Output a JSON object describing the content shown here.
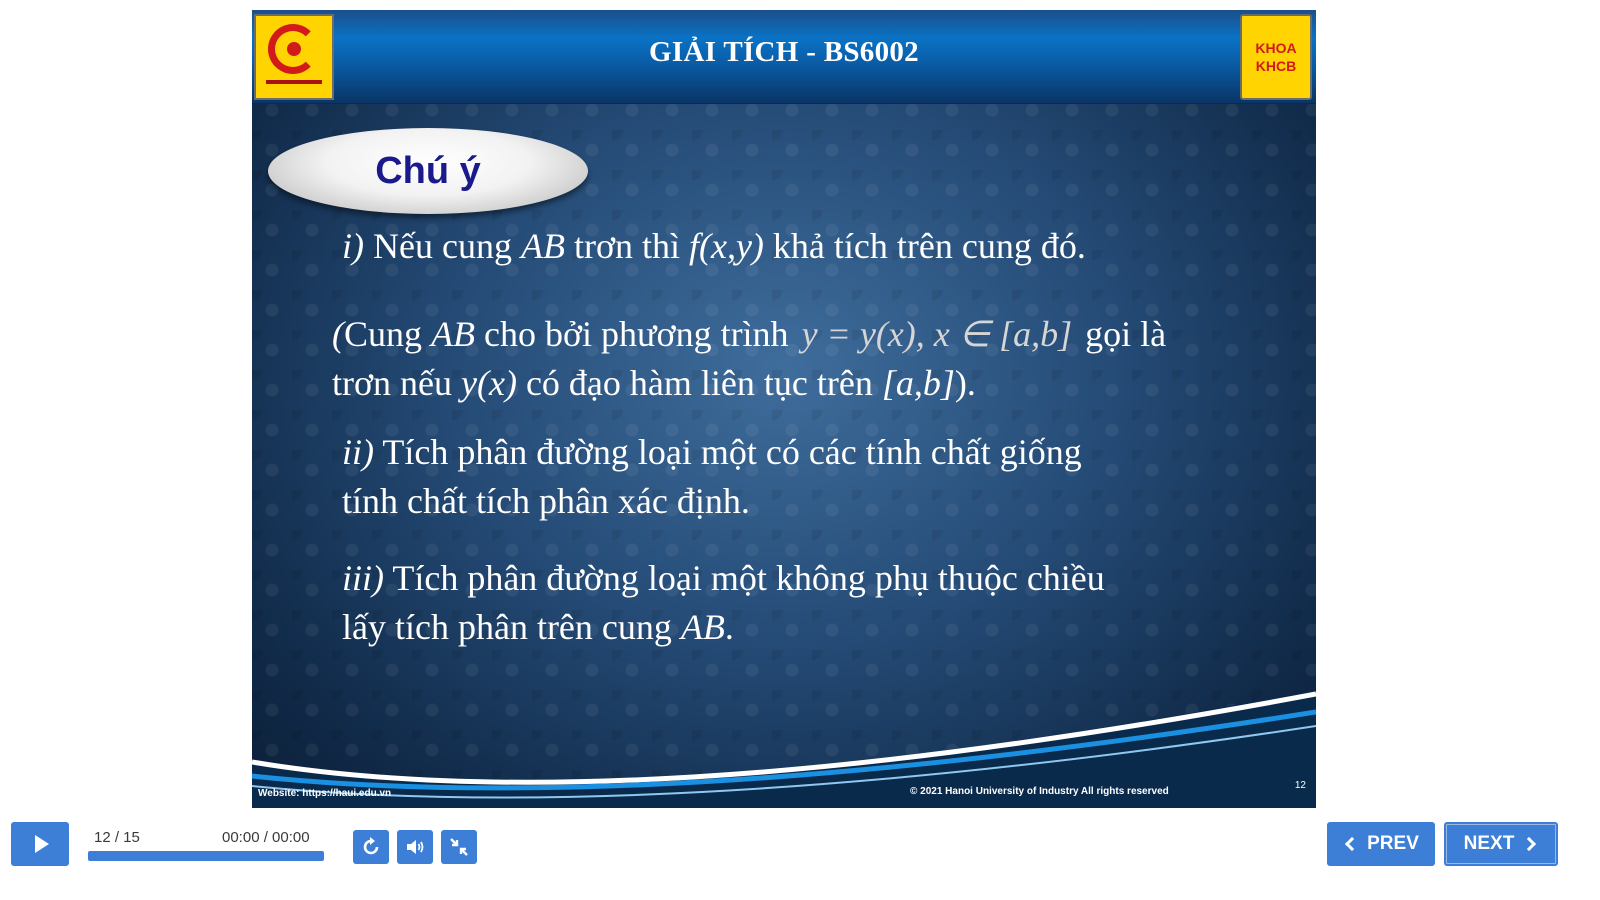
{
  "slide": {
    "header_title": "GIẢI TÍCH - BS6002",
    "right_logo_line1": "KHOA",
    "right_logo_line2": "KHCB",
    "note_title": "Chú ý",
    "line1": {
      "a": "i)",
      "b": " Nếu cung ",
      "c": "AB",
      "d": " trơn thì ",
      "e": "f(x,y)",
      "f": " khả tích trên cung đó."
    },
    "line2": {
      "a": "(",
      "b": "Cung ",
      "c": "AB",
      "d": " cho bởi phương trình ",
      "math": "y = y(x), x ∈ [a,b]",
      "e": " gọi là",
      "f": "trơn nếu ",
      "g": "y(x)",
      "h": " có đạo hàm liên tục trên ",
      "i": "[a,b]",
      "j": ")."
    },
    "line3": {
      "a": "ii)",
      "b": " Tích phân đường loại một có các tính chất giống",
      "c": "tính chất tích phân xác định."
    },
    "line4": {
      "a": "iii)",
      "b": " Tích phân đường loại một không phụ thuộc chiều",
      "c": "lấy tích phân trên cung ",
      "d": "AB",
      "e": "."
    },
    "footer_website": "Website: https://haui.edu.vn",
    "footer_copyright": "© 2021 Hanoi University of Industry All rights reserved",
    "page_number": "12"
  },
  "player": {
    "slide_counter": "12 / 15",
    "time": "00:00 / 00:00",
    "progress_fraction": 1.0,
    "prev_label": "PREV",
    "next_label": "NEXT",
    "icons": [
      "play-icon",
      "replay-icon",
      "volume-icon",
      "exit-fullscreen-icon",
      "chevron-left-icon",
      "chevron-right-icon"
    ],
    "accent_color": "#3d7fd6"
  }
}
